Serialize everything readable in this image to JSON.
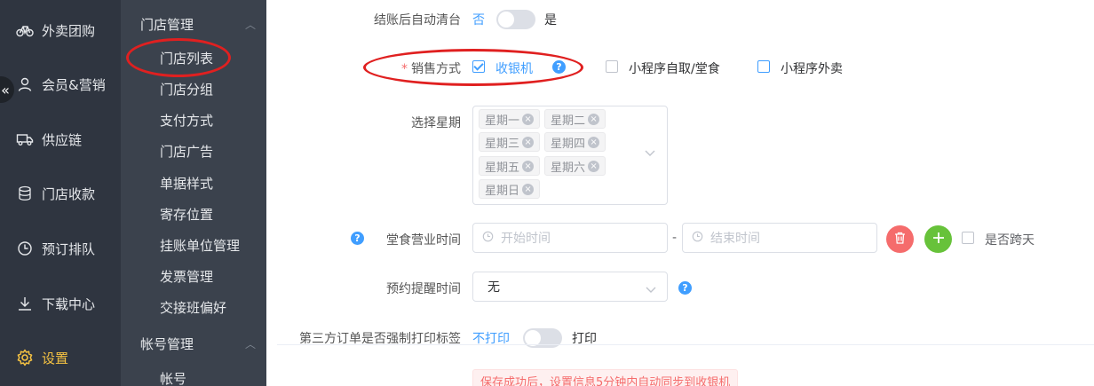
{
  "sidebar": {
    "collapse_glyph": "«",
    "items": [
      {
        "label": "外卖团购",
        "icon": "bike-icon"
      },
      {
        "label": "会员&营销",
        "icon": "user-icon"
      },
      {
        "label": "供应链",
        "icon": "truck-icon"
      },
      {
        "label": "门店收款",
        "icon": "coins-icon"
      },
      {
        "label": "预订排队",
        "icon": "clock-icon"
      },
      {
        "label": "下载中心",
        "icon": "download-icon"
      },
      {
        "label": "设置",
        "icon": "gear-icon",
        "active": true
      }
    ]
  },
  "subnav": {
    "group1": "门店管理",
    "items": [
      "门店列表",
      "门店分组",
      "支付方式",
      "门店广告",
      "单据样式",
      "寄存位置",
      "挂账单位管理",
      "发票管理",
      "交接班偏好"
    ],
    "group2": "帐号管理",
    "group2_items": [
      "帐号"
    ]
  },
  "form": {
    "auto_clear": {
      "label": "结账后自动清台",
      "off": "否",
      "on": "是"
    },
    "sales_mode": {
      "required_mark": "*",
      "label": "销售方式",
      "options": [
        {
          "label": "收银机",
          "checked": true
        },
        {
          "label": "小程序自取/堂食",
          "checked": false
        },
        {
          "label": "小程序外卖",
          "checked": false
        }
      ]
    },
    "weekday": {
      "label": "选择星期",
      "tags": [
        "星期一",
        "星期二",
        "星期三",
        "星期四",
        "星期五",
        "星期六",
        "星期日"
      ]
    },
    "dine_hours": {
      "label": "堂食营业时间",
      "start_placeholder": "开始时间",
      "separator": "-",
      "end_placeholder": "结束时间",
      "cross_day": "是否跨天"
    },
    "reminder": {
      "label": "预约提醒时间",
      "value": "无"
    },
    "force_print": {
      "label": "第三方订单是否强制打印标签",
      "off": "不打印",
      "on": "打印"
    },
    "notice": "保存成功后，设置信息5分钟内自动同步到收银机"
  },
  "colors": {
    "accent": "#409eff",
    "highlight": "#e02020",
    "active_menu": "#f5c242",
    "danger": "#f56c6c",
    "success": "#67c23a"
  }
}
